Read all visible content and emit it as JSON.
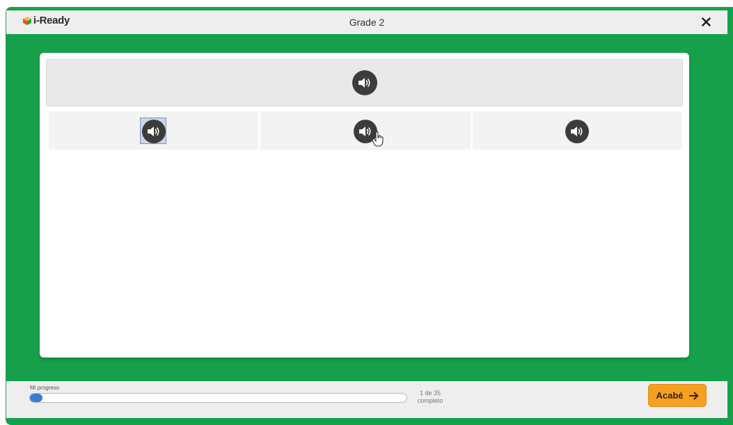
{
  "app": {
    "logo_text": "i-Ready",
    "title": "Grade 2",
    "close_label": "×"
  },
  "colors": {
    "frame_green": "#17a04b",
    "speaker_button": "#3c3c3c",
    "progress_fill": "#3c7dd3",
    "done_button": "#f6a021"
  },
  "prompt": {
    "icon": "speaker-icon"
  },
  "choices": [
    {
      "icon": "speaker-icon",
      "focused": true
    },
    {
      "icon": "speaker-icon",
      "hovered": true
    },
    {
      "icon": "speaker-icon"
    }
  ],
  "footer": {
    "progress_label": "Mi progreso",
    "progress_fraction": 0.0286,
    "progress_count": "1 de 35",
    "progress_status": "completo",
    "done_label": "Acabé",
    "done_icon": "arrow-right-icon"
  }
}
